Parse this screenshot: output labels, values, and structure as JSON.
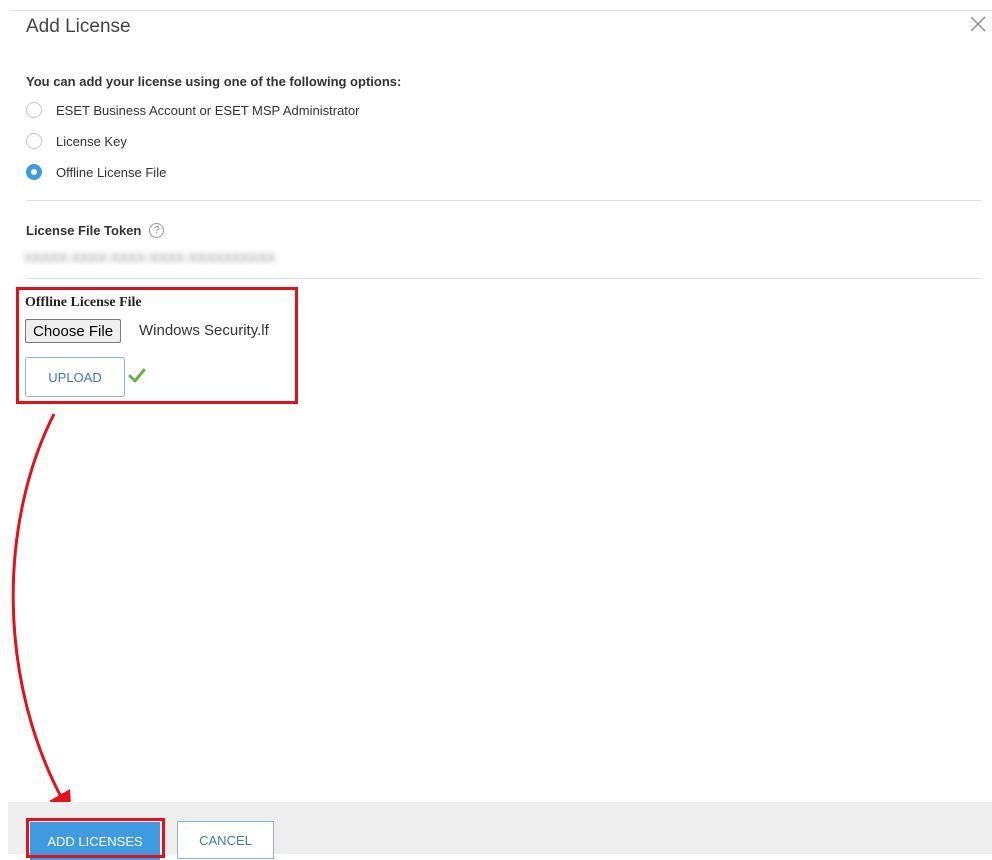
{
  "dialog": {
    "title": "Add License",
    "intro": "You can add your license using one of the following options:",
    "options": [
      {
        "label": "ESET Business Account or ESET MSP Administrator",
        "checked": false
      },
      {
        "label": "License Key",
        "checked": false
      },
      {
        "label": "Offline License File",
        "checked": true
      }
    ],
    "token": {
      "label": "License File Token",
      "value": "XXXXX-XXXX-XXXX-XXXX-XXXXXXXXXX"
    },
    "offline_file": {
      "label": "Offline License File",
      "choose_label": "Choose File",
      "file_name": "Windows Security.lf",
      "upload_label": "UPLOAD"
    }
  },
  "footer": {
    "add_label": "ADD LICENSES",
    "cancel_label": "CANCEL"
  },
  "colors": {
    "accent": "#3f9ae0",
    "annotation": "#e1121a",
    "success": "#6ab04c"
  },
  "icons": {
    "close": "close-icon",
    "help": "help-icon",
    "check": "check-icon"
  }
}
